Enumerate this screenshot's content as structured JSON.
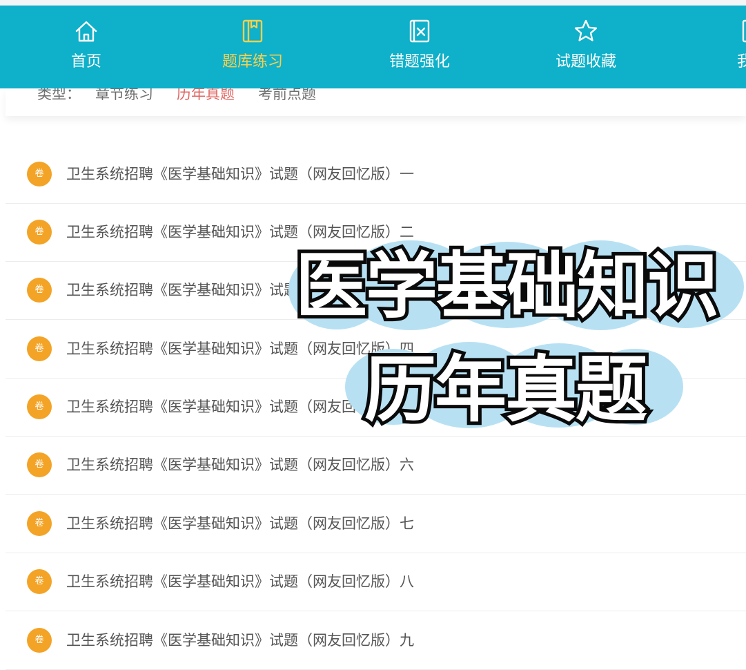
{
  "nav": {
    "items": [
      {
        "label": "首页",
        "icon": "home-icon",
        "active": false
      },
      {
        "label": "题库练习",
        "icon": "book-icon",
        "active": true
      },
      {
        "label": "错题强化",
        "icon": "wrong-question-icon",
        "active": false
      },
      {
        "label": "试题收藏",
        "icon": "star-icon",
        "active": false
      },
      {
        "label": "我的",
        "icon": "user-icon",
        "active": false
      }
    ]
  },
  "filter": {
    "label": "类型：",
    "options": [
      "章节练习",
      "历年真题",
      "考前点题"
    ],
    "active": "历年真题"
  },
  "list": {
    "badge": "卷",
    "items": [
      "卫生系统招聘《医学基础知识》试题（网友回忆版）一",
      "卫生系统招聘《医学基础知识》试题（网友回忆版）二",
      "卫生系统招聘《医学基础知识》试题（网友回忆版）三",
      "卫生系统招聘《医学基础知识》试题（网友回忆版）四",
      "卫生系统招聘《医学基础知识》试题（网友回忆版）五",
      "卫生系统招聘《医学基础知识》试题（网友回忆版）六",
      "卫生系统招聘《医学基础知识》试题（网友回忆版）七",
      "卫生系统招聘《医学基础知识》试题（网友回忆版）八",
      "卫生系统招聘《医学基础知识》试题（网友回忆版）九"
    ]
  },
  "overlay": {
    "line1": "医学基础知识",
    "line2": "历年真题"
  },
  "colors": {
    "nav_bg": "#0fb0c9",
    "nav_active": "#f7d04d",
    "filter_active": "#e06560",
    "badge": "#f3a326",
    "cloud": "#b7e1f3"
  }
}
